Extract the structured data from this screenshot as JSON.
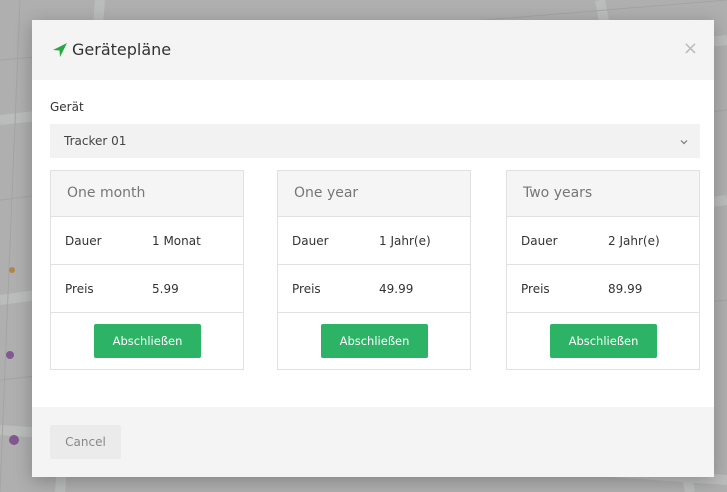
{
  "modal": {
    "title": "Gerätepläne",
    "title_icon": "location-arrow-icon",
    "close_label": "×"
  },
  "device": {
    "label": "Gerät",
    "selected": "Tracker 01"
  },
  "plans": [
    {
      "name": "One month",
      "duration_label": "Dauer",
      "duration_value": "1 Monat",
      "price_label": "Preis",
      "price_value": "5.99",
      "button_label": "Abschließen"
    },
    {
      "name": "One year",
      "duration_label": "Dauer",
      "duration_value": "1 Jahr(e)",
      "price_label": "Preis",
      "price_value": "49.99",
      "button_label": "Abschließen"
    },
    {
      "name": "Two years",
      "duration_label": "Dauer",
      "duration_value": "2 Jahr(e)",
      "price_label": "Preis",
      "price_value": "89.99",
      "button_label": "Abschließen"
    }
  ],
  "footer": {
    "cancel_label": "Cancel"
  },
  "colors": {
    "accent": "#2db366",
    "icon_green": "#27a844",
    "backdrop": "#d6d1c9"
  }
}
